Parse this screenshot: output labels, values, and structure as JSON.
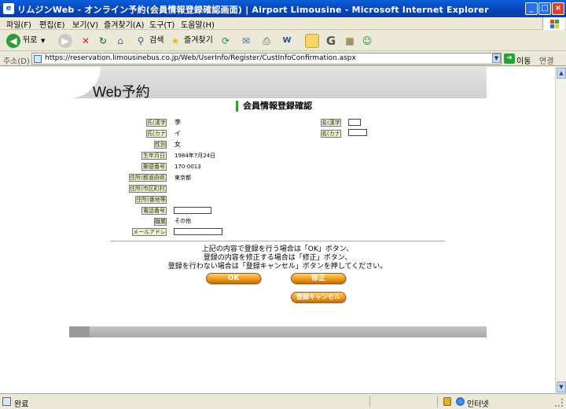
{
  "window": {
    "title": "リムジンWeb - オンライン予約(会員情報登録確認画面) | Airport Limousine - Microsoft Internet Explorer"
  },
  "menu": [
    "파일(F)",
    "편집(E)",
    "보기(V)",
    "즐겨찾기(A)",
    "도구(T)",
    "도움말(H)"
  ],
  "toolbar": {
    "back_label": "뒤로",
    "search_label": "검색",
    "favorites_label": "즐겨찾기"
  },
  "address": {
    "label": "주소(D)",
    "url": "https://reservation.limousinebus.co.jp/Web/UserInfo/Register/CustInfoConfirmation.aspx",
    "go_label": "이동",
    "links_label": "연결"
  },
  "page": {
    "logo": "Web予約",
    "section_title": "会員情報登録確認",
    "fields": {
      "surname_kanji": {
        "label": "氏(漢字)",
        "value": "李"
      },
      "given_kanji": {
        "label": "名(漢字)",
        "value": ""
      },
      "surname_kana": {
        "label": "氏(カナ)",
        "value": "イ"
      },
      "given_kana": {
        "label": "名(カナ)",
        "value": ""
      },
      "gender": {
        "label": "性別",
        "value": "女"
      },
      "birthdate": {
        "label": "生年月日",
        "value": "1984年7月24日"
      },
      "postal_code": {
        "label": "郵便番号",
        "value": "170-0013"
      },
      "prefecture": {
        "label": "住所(都道府県)",
        "value": "東京都"
      },
      "city": {
        "label": "住所(市区町村)",
        "value": ""
      },
      "street": {
        "label": "住所(番地等)",
        "value": ""
      },
      "phone": {
        "label": "電話番号",
        "value": ""
      },
      "occupation": {
        "label": "職業",
        "value": "その他"
      },
      "email": {
        "label": "メールアドレス",
        "value": ""
      }
    },
    "instructions": [
      "上記の内容で登録を行う場合は「OK」ボタン、",
      "登録の内容を修正する場合は「修正」ボタン、",
      "登録を行わない場合は「登録キャンセル」ボタンを押してください。"
    ],
    "buttons": {
      "ok": "OK",
      "edit": "修正",
      "cancel": "登録キャンセル"
    }
  },
  "status": {
    "text": "완료",
    "zone": "인터넷"
  }
}
